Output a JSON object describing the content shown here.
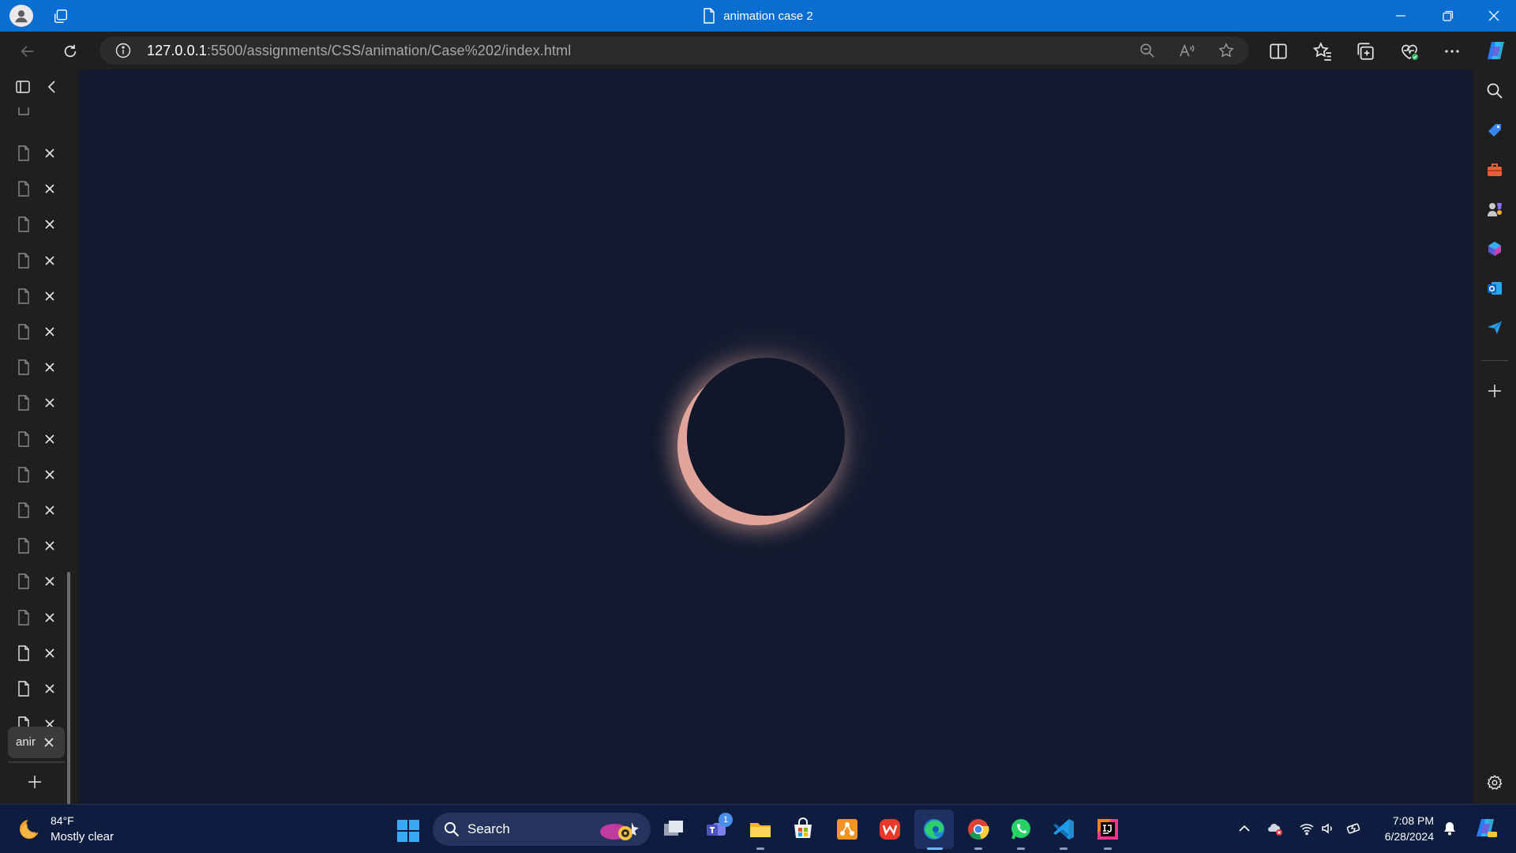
{
  "window": {
    "title": "animation case 2"
  },
  "address_bar": {
    "url_host": "127.0.0.1",
    "url_rest": ":5500/assignments/CSS/animation/Case%202/index.html"
  },
  "vertical_tabs": {
    "tab_count_closable": 17,
    "active_tab_label": "anir"
  },
  "page": {
    "background_color": "#131a2f",
    "eclipse_core_color": "#111628",
    "eclipse_glow_color": "#e0a49a"
  },
  "taskbar": {
    "weather_temp": "84°F",
    "weather_condition": "Mostly clear",
    "search_label": "Search",
    "teams_badge": "1",
    "time": "7:08 PM",
    "date": "6/28/2024"
  },
  "icons": {
    "titlebar": [
      "profile-icon",
      "workspaces-icon",
      "document-icon",
      "minimize-icon",
      "restore-icon",
      "close-icon"
    ],
    "navbar": [
      "back-icon",
      "refresh-icon",
      "info-icon",
      "zoom-out-icon",
      "read-aloud-icon",
      "favorite-star-icon",
      "split-screen-icon",
      "favorites-icon",
      "collections-icon",
      "browser-essentials-icon",
      "more-icon",
      "copilot-icon"
    ],
    "sidebar_right": [
      "search-icon",
      "shopping-icon",
      "tools-icon",
      "games-icon",
      "microsoft-365-icon",
      "outlook-icon",
      "drop-icon",
      "add-icon",
      "settings-icon"
    ]
  }
}
